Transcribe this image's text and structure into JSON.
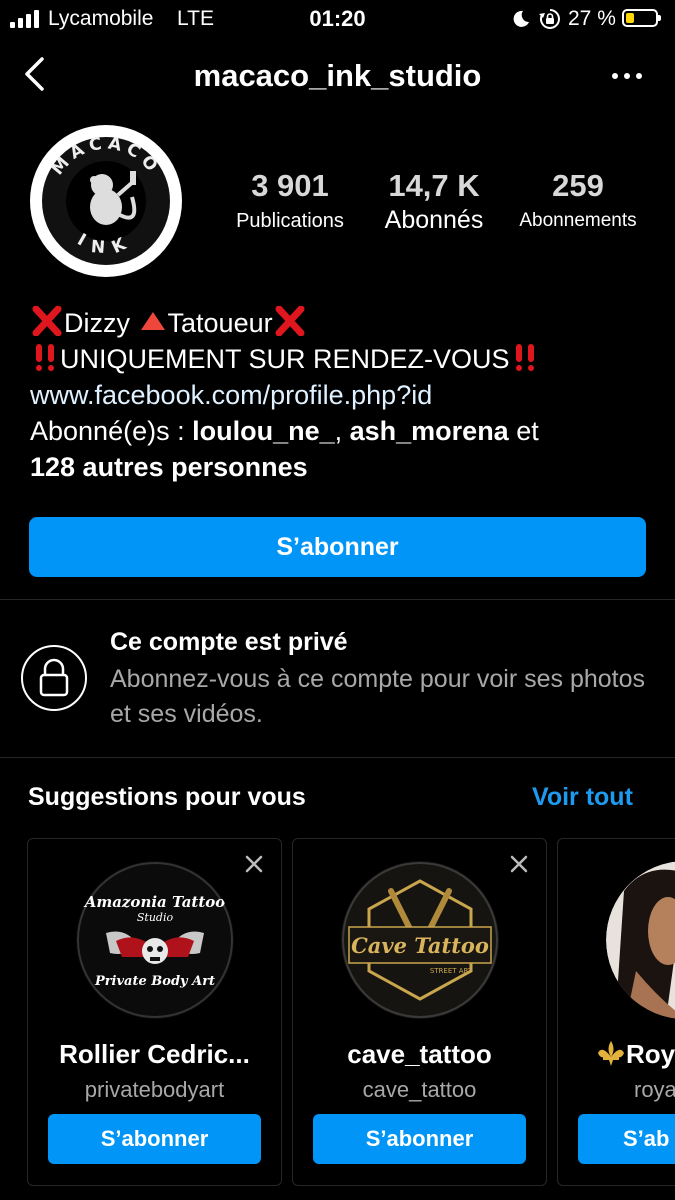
{
  "status_bar": {
    "carrier": "Lycamobile",
    "network": "LTE",
    "time": "01:20",
    "battery_percent_label": "27 %",
    "battery_level": 0.27,
    "battery_color": "#ffd60a"
  },
  "header": {
    "username": "macaco_ink_studio",
    "back_icon": "chevron-left-icon",
    "more_icon": "more-horizontal-icon"
  },
  "profile": {
    "avatar_logo_text": "MACACO INK",
    "stats": [
      {
        "value": "3 901",
        "label": "Publications"
      },
      {
        "value": "14,7 K",
        "label": "Abonnés"
      },
      {
        "value": "259",
        "label": "Abonnements"
      }
    ]
  },
  "bio": {
    "line1_a": "Dizzy",
    "line1_b": "Tatoueur",
    "line2": "UNIQUEMENT SUR RENDEZ-VOUS",
    "link": "www.facebook.com/profile.php?id",
    "followed_by_prefix": "Abonné(e)s : ",
    "followed_user1": "loulou_ne_",
    "followed_sep": ", ",
    "followed_user2": "ash_morena",
    "followed_and": " et",
    "followed_others": "128 autres personnes"
  },
  "follow_button": "S’abonner",
  "private": {
    "title": "Ce compte est privé",
    "subtitle": "Abonnez-vous à ce compte pour voir ses photos et ses vidéos."
  },
  "suggestions": {
    "title": "Suggestions pour vous",
    "see_all": "Voir tout",
    "accent_color": "#1d9bf0",
    "cards": [
      {
        "name": "Rollier Cedric...",
        "username": "privatebodyart",
        "button": "S’abonner",
        "logo_top": "Amazonia Tattoo",
        "logo_mid": "Studio",
        "logo_bottom": "Private Body Art"
      },
      {
        "name": "cave_tattoo",
        "username": "cave_tattoo",
        "button": "S’abonner",
        "logo_main": "Cave Tattoo",
        "logo_sub": "STREET ART"
      },
      {
        "name": "Roy",
        "username": "roya",
        "button": "S’ab"
      }
    ]
  },
  "colors": {
    "background": "#000000",
    "button_blue": "#0095f6",
    "secondary_text": "#a8a8a8",
    "separator": "#262626"
  }
}
